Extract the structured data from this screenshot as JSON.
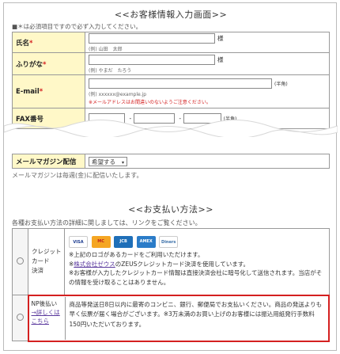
{
  "customer": {
    "heading": "<<お客様情報入力画面>>",
    "required_note": "■＊は必須項目ですので必ず入力してください。",
    "name": {
      "label": "氏名",
      "req": "*",
      "suffix": "様",
      "example": "(例) 山田　太郎"
    },
    "furigana": {
      "label": "ふりがな",
      "req": "*",
      "suffix": "様",
      "example": "(例) やまだ　たろう"
    },
    "email": {
      "label": "E-mail",
      "req": "*",
      "suffix": "(半角)",
      "example": "(例) xxxxxx@example.jp",
      "warning": "※メールアドレスはお間違いのないようご注意ください。"
    },
    "fax": {
      "label": "FAX番号",
      "dash1": "-",
      "dash2": "-",
      "suffix": "(半角)"
    },
    "magazine": {
      "label": "メールマガジン配信",
      "value": "希望する",
      "arrow": "▾",
      "note": "メールマガジンは毎週(金)に配信いたします。"
    }
  },
  "payment": {
    "heading": "<<お支払い方法>>",
    "intro": "各種お支払い方法の詳細に関しましては、リンクをご覧ください。",
    "credit": {
      "label_lines": [
        "クレジット",
        "カード",
        "決済"
      ],
      "cards": [
        {
          "name": "VISA",
          "icon": "visa-card-icon",
          "color": "#1a3a8f"
        },
        {
          "name": "MC",
          "icon": "mastercard-icon",
          "color": "#e8690e"
        },
        {
          "name": "JCB",
          "icon": "jcb-card-icon",
          "color": "#1f6fb8"
        },
        {
          "name": "AMEX",
          "icon": "amex-card-icon",
          "color": "#2b7cc8"
        },
        {
          "name": "Diners",
          "icon": "diners-card-icon",
          "color": "#3a6fa8"
        }
      ],
      "note1": "※上記のロゴがあるカードをご利用いただけます。",
      "note2_prefix": "※",
      "note2_link": "株式会社ゼウス",
      "note2_suffix": "のZEUSクレジットカード決済を使用しています。",
      "note3": "※お客様が入力したクレジットカード情報は直接決済会社に暗号化して送信されます。当店がその情報を受け取ることはありません。"
    },
    "np": {
      "label": "NP後払い",
      "link": "→詳しくはこちら",
      "note": "商品等発送日8日以内に最寄のコンビニ、銀行、郵便局でお支払いください。商品の発送よりも早く伝票が届く場合がございます。※3万未満のお買い上げのお客様には振込用紙発行手数料150円いただいております。"
    }
  }
}
